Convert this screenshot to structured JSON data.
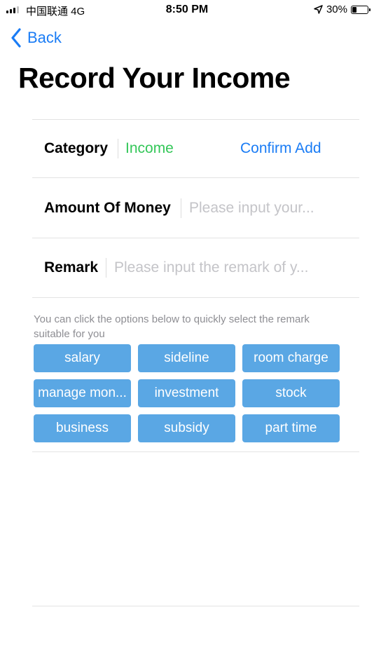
{
  "status_bar": {
    "carrier": "中国联通  4G",
    "time": "8:50 PM",
    "battery_text": "30%",
    "battery_level": 0.3
  },
  "nav": {
    "back_label": "Back",
    "accent_color": "#1a7cf5"
  },
  "page": {
    "title": "Record Your Income"
  },
  "form": {
    "category_label": "Category",
    "category_value": "Income",
    "category_color": "#34c759",
    "confirm_label": "Confirm Add",
    "amount_label": "Amount Of Money",
    "amount_value": "",
    "amount_placeholder": "Please input your...",
    "remark_label": "Remark",
    "remark_value": "",
    "remark_placeholder": "Please input the remark of y..."
  },
  "quick_select": {
    "hint": "You can click the options below to quickly select the remark suitable for you",
    "chip_color": "#5aa7e4",
    "options": [
      "salary",
      "sideline",
      "room charge",
      "manage mon...",
      "investment",
      "stock",
      "business",
      "subsidy",
      "part time"
    ]
  }
}
